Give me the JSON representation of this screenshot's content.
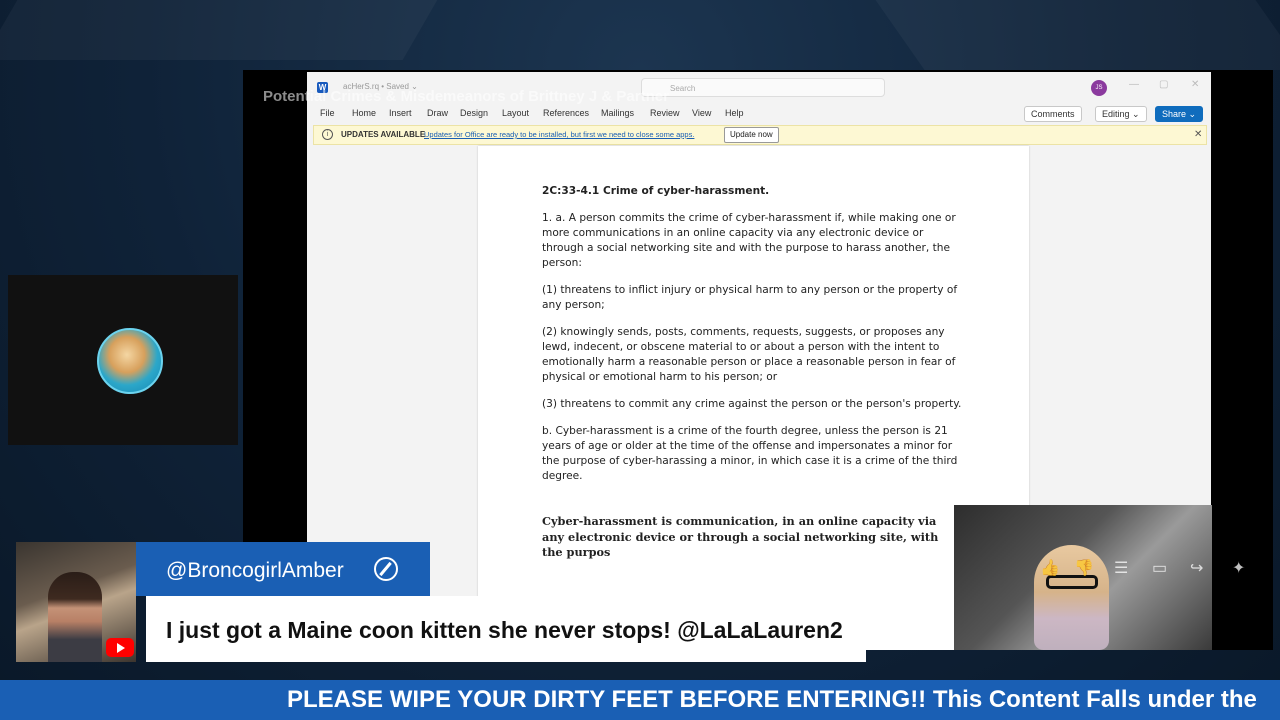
{
  "stream": {
    "shared_window_title": "Potential Crimes & Misdemeanors of Brittney J & Partner",
    "ticker_text": "PLEASE WIPE YOUR DIRTY FEET BEFORE ENTERING!! This Content Falls under the"
  },
  "word": {
    "doc_name": "acHerS.rq • Saved ⌄",
    "search_placeholder": "Search",
    "user_initials": "JS",
    "menu": [
      "File",
      "Home",
      "Insert",
      "Draw",
      "Design",
      "Layout",
      "References",
      "Mailings",
      "Review",
      "View",
      "Help"
    ],
    "comments_label": "Comments",
    "editing_label": "Editing ⌄",
    "share_label": "Share ⌄",
    "update_bar": {
      "title": "UPDATES AVAILABLE",
      "message": "Updates for Office are ready to be installed, but first we need to close some apps.",
      "button": "Update now"
    }
  },
  "document": {
    "heading": "2C:33-4.1 Crime of cyber-harassment.",
    "para1": "1. a. A person commits the crime of cyber-harassment if, while making one or more communications in an online capacity via any electronic device or through a social networking site and with the purpose to harass another, the person:",
    "para2": "(1) threatens to inflict injury or physical harm to any person or the property of any person;",
    "para3": "(2) knowingly sends, posts, comments, requests, suggests, or proposes any lewd, indecent, or obscene material to or about a person with the intent to emotionally harm a reasonable person or place a reasonable person in fear of physical or emotional harm to his person; or",
    "para4": "(3) threatens to commit any crime against the person or the person's property.",
    "para5": "b. Cyber-harassment is a crime of the fourth degree, unless the person is 21 years of age or older at the time of the offense and impersonates a minor for the purpose of cyber-harassing a minor, in which case it is a crime of the third degree.",
    "summary": "Cyber-harassment is communication, in an online capacity via any electronic device or through a social networking site, with the purpos"
  },
  "chat": {
    "username": "@BroncogirlAmber",
    "message": "I just got a Maine coon kitten she never stops! @LaLaLauren2"
  },
  "icons": {
    "reactions": [
      "thumbs-up-icon",
      "thumbs-down-icon",
      "comment-icon",
      "chat-icon",
      "share-icon",
      "sparkle-icon"
    ],
    "reaction_glyphs": [
      "👍",
      "👎",
      "☰",
      "▭",
      "↪",
      "✦"
    ]
  },
  "colors": {
    "brand_blue": "#1a5fb4",
    "youtube_red": "#ff0000",
    "word_blue": "#185abd"
  }
}
